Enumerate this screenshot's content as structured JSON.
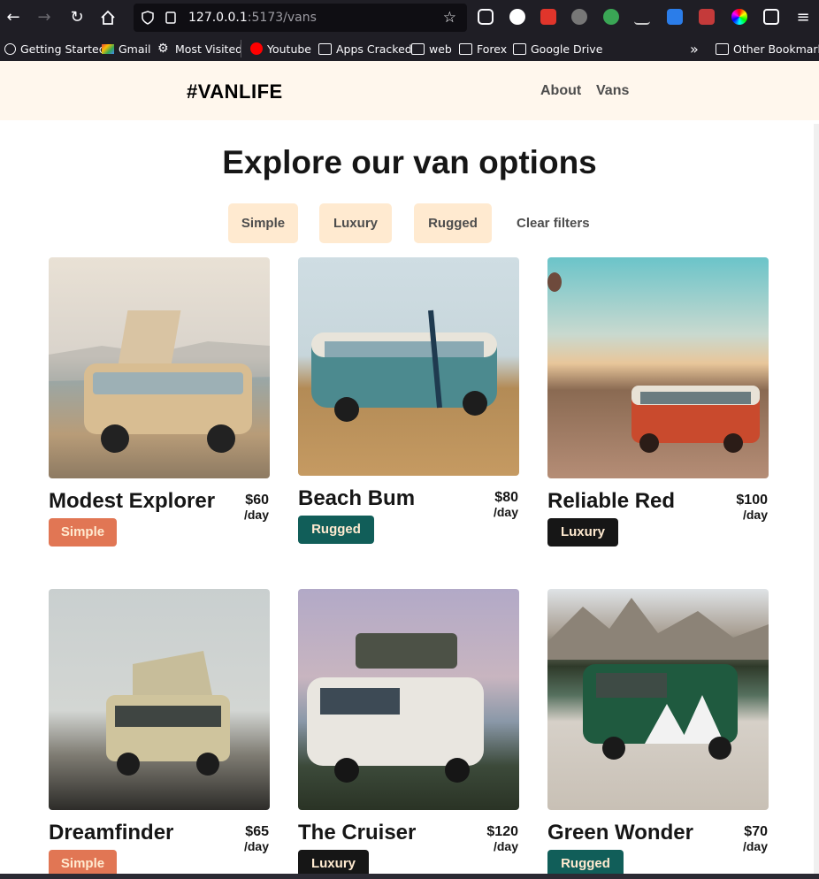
{
  "browser": {
    "url_host": "127.0.0.1",
    "url_path": ":5173/vans",
    "bookmarks": [
      "Getting Started",
      "Gmail",
      "Most Visited",
      "Youtube",
      "Apps Cracked",
      "web",
      "Forex",
      "Google Drive"
    ],
    "other_bookmarks": "Other Bookmarks"
  },
  "header": {
    "logo": "#VANLIFE",
    "nav": [
      "About",
      "Vans"
    ]
  },
  "main": {
    "title": "Explore our van options",
    "filters": [
      "Simple",
      "Luxury",
      "Rugged"
    ],
    "clear_filters": "Clear filters"
  },
  "vans": [
    {
      "name": "Modest Explorer",
      "price": "$60",
      "per": "/day",
      "type": "Simple"
    },
    {
      "name": "Beach Bum",
      "price": "$80",
      "per": "/day",
      "type": "Rugged"
    },
    {
      "name": "Reliable Red",
      "price": "$100",
      "per": "/day",
      "type": "Luxury"
    },
    {
      "name": "Dreamfinder",
      "price": "$65",
      "per": "/day",
      "type": "Simple"
    },
    {
      "name": "The Cruiser",
      "price": "$120",
      "per": "/day",
      "type": "Luxury"
    },
    {
      "name": "Green Wonder",
      "price": "$70",
      "per": "/day",
      "type": "Rugged"
    }
  ],
  "colors": {
    "header_bg": "#fff7ed",
    "filter_bg": "#ffead0",
    "simple": "#e17654",
    "rugged": "#115e59",
    "luxury": "#161616"
  }
}
